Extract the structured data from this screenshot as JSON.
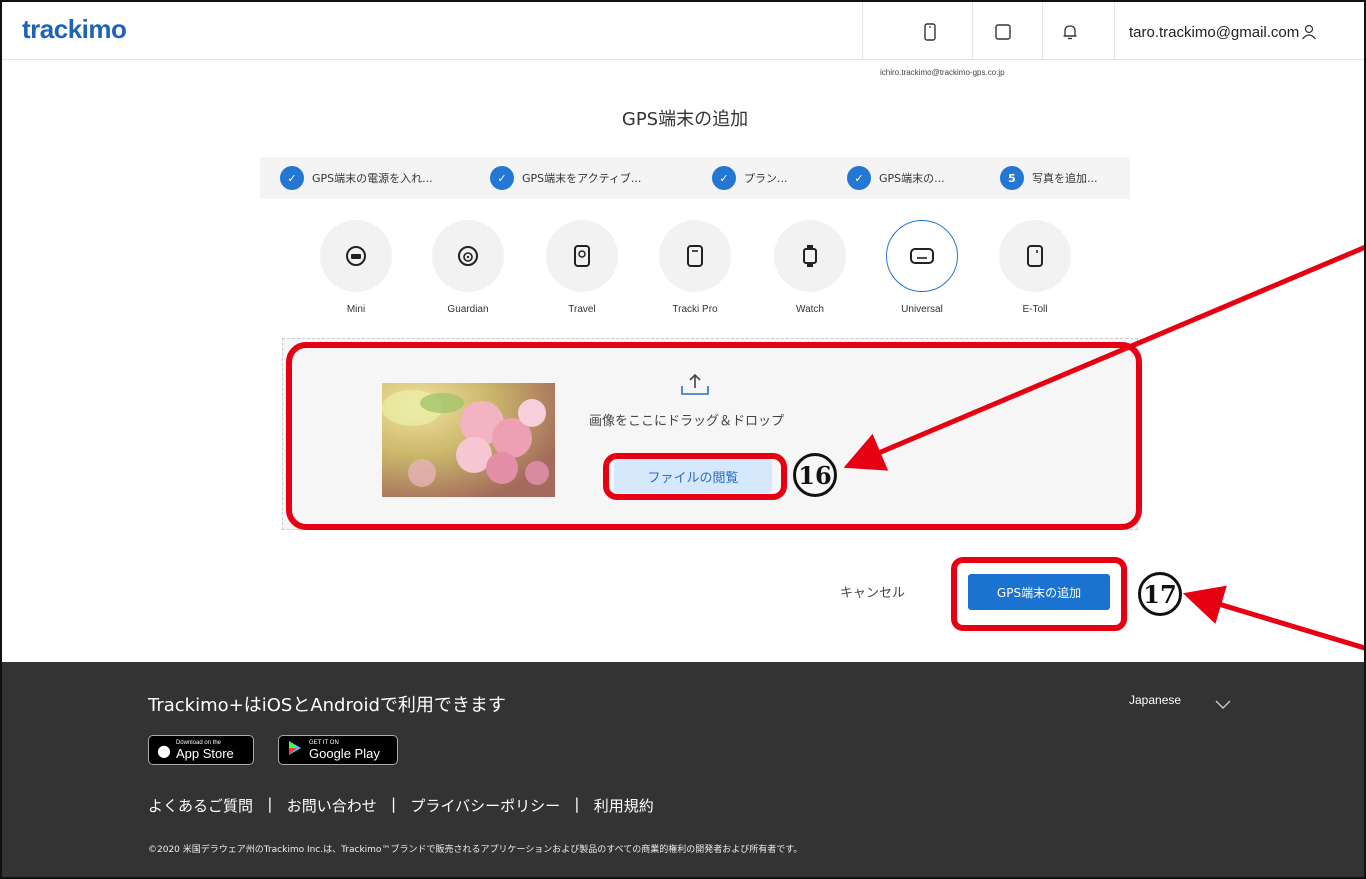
{
  "header": {
    "logo": "trackimo",
    "email": "taro.trackimo@gmail.com",
    "sub_email": "ichiro.trackimo@trackimo-gps.co.jp",
    "icons": [
      "device-icon",
      "square-icon",
      "bell-icon",
      "user-icon"
    ]
  },
  "page": {
    "title": "GPS端末の追加"
  },
  "steps": [
    {
      "label": "GPS端末の電源を入れ...",
      "marker": "✓"
    },
    {
      "label": "GPS端末をアクティブ...",
      "marker": "✓"
    },
    {
      "label": "プラン...",
      "marker": "✓"
    },
    {
      "label": "GPS端末の...",
      "marker": "✓"
    },
    {
      "label": "写真を追加...",
      "marker": "5"
    }
  ],
  "devices": [
    {
      "label": "Mini",
      "icon": "mini-device-icon"
    },
    {
      "label": "Guardian",
      "icon": "guardian-device-icon"
    },
    {
      "label": "Travel",
      "icon": "travel-device-icon"
    },
    {
      "label": "Tracki Pro",
      "icon": "tracki-pro-device-icon"
    },
    {
      "label": "Watch",
      "icon": "watch-device-icon"
    },
    {
      "label": "Universal",
      "icon": "universal-device-icon",
      "selected": true
    },
    {
      "label": "E-Toll",
      "icon": "e-toll-device-icon"
    }
  ],
  "upload": {
    "drag_text": "画像をここにドラッグ＆ドロップ",
    "browse_label": "ファイルの閲覧"
  },
  "actions": {
    "cancel_label": "キャンセル",
    "add_label": "GPS端末の追加"
  },
  "annotations": {
    "step16": "16",
    "step17": "17",
    "color": "#e60012"
  },
  "footer": {
    "title": "Trackimo+はiOSとAndroidで利用できます",
    "language": "Japanese",
    "app_store_small": "Download on the",
    "app_store_big": "App Store",
    "google_play_small": "GET IT ON",
    "google_play_big": "Google Play",
    "links": [
      "よくあるご質問",
      "お問い合わせ",
      "プライバシーポリシー",
      "利用規約"
    ],
    "separator": "|",
    "copyright": "©2020 米国デラウェア州のTrackimo Inc.は、Trackimo™ブランドで販売されるアプリケーションおよび製品のすべての商業的権利の開発者および所有者です。"
  },
  "colors": {
    "brand_blue": "#1e63b5",
    "primary_button": "#1a73d1",
    "step_circle": "#2477d3",
    "footer_bg": "#333333"
  }
}
